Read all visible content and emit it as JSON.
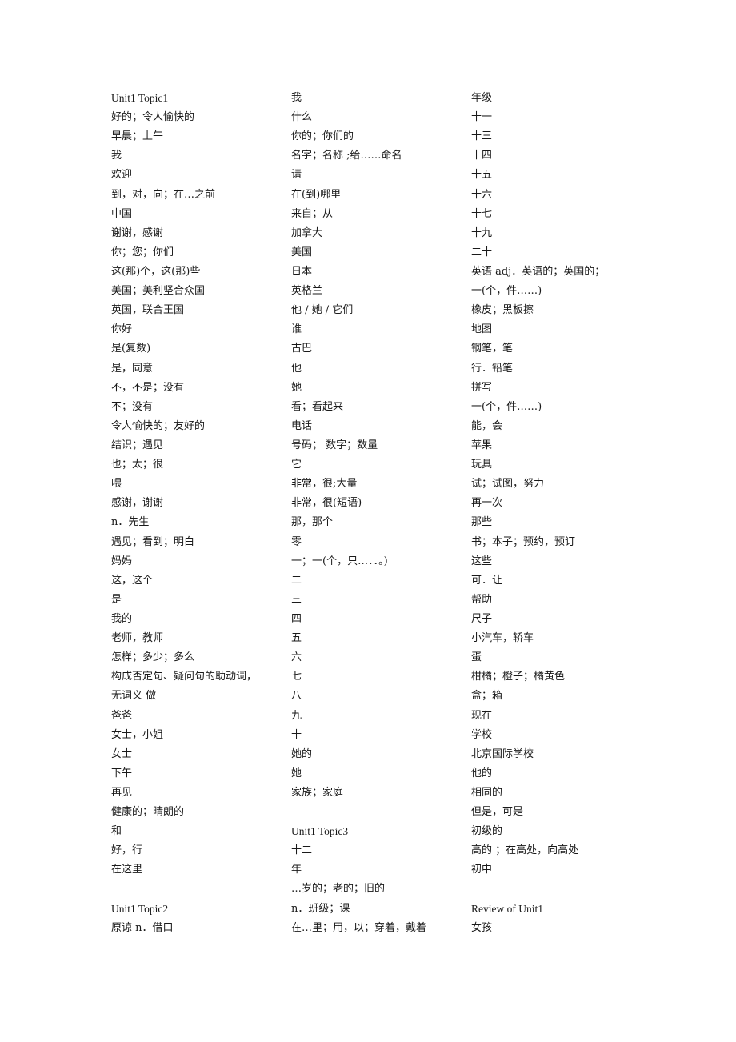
{
  "document": {
    "columns": [
      {
        "sections": [
          {
            "heading": "Unit1 Topic1",
            "entries": [
              "好的；令人愉快的",
              "早晨；上午",
              "我",
              "欢迎",
              "到，对，向；在…之前",
              "中国",
              "谢谢，感谢",
              "你；您；你们",
              "这(那)个，这(那)些",
              "美国；美利坚合众国",
              "英国，联合王国",
              "你好",
              "是(复数)",
              "是，同意",
              "不，不是；没有",
              "不；没有",
              "令人愉快的；友好的",
              "结识；遇见",
              "也；太；很",
              "喂",
              "感谢，谢谢",
              "n．先生",
              "遇见；看到；明白",
              "妈妈",
              "这，这个",
              "是",
              "我的",
              "老师，教师",
              "怎样；多少；多么",
              "构成否定句、疑问句的助动词，",
              "无词义  做",
              "爸爸",
              "女士，小姐",
              "女士",
              "下午",
              "再见",
              "健康的；晴朗的",
              "和",
              "好，行",
              "在这里"
            ]
          },
          {
            "heading": "Unit1 Topic2",
            "entries": [
              "原谅  n．借口"
            ]
          }
        ]
      },
      {
        "sections": [
          {
            "heading": null,
            "entries": [
              "我",
              "什么",
              "你的；你们的",
              "名字；名称  ;给……命名",
              "请",
              "在(到)哪里",
              "来自；从",
              "加拿大",
              "美国",
              "日本",
              "英格兰",
              "他 / 她 / 它们",
              "谁",
              "古巴",
              "他",
              "她",
              "看；看起来",
              "电话",
              "号码；  数字；数量",
              "它",
              "非常，很;大量",
              "非常，很(短语)",
              "那，那个",
              "零",
              "一；一(个，只…．．。)",
              "二",
              "三",
              "四",
              "五",
              "六",
              "七",
              "八",
              "九",
              "十",
              "她的",
              "她",
              "家族；家庭"
            ]
          },
          {
            "heading": "Unit1 Topic3",
            "entries": [
              "十二",
              "年",
              "…岁的；老的；旧的",
              "n．班级；课",
              "在…里；用，以；穿着，戴着"
            ]
          }
        ]
      },
      {
        "sections": [
          {
            "heading": null,
            "entries": [
              "年级",
              "十一",
              "十三",
              "十四",
              "十五",
              "十六",
              "十七",
              "十九",
              "二十",
              "英语      adj．英语的；英国的；",
              "一(个，件……)",
              "橡皮；黑板擦",
              "地图",
              "钢笔，笔",
              "行．铅笔",
              "拼写",
              "一(个，件……)",
              "能，会",
              "苹果",
              "玩具",
              "试；试图，努力",
              "再一次",
              "那些",
              "书；本子；预约，预订",
              "这些",
              "可．让",
              "帮助",
              "尺子",
              "小汽车，轿车",
              "蛋",
              "柑橘；橙子；橘黄色",
              "盒；箱",
              "现在",
              "学校",
              "北京国际学校",
              "他的",
              "相同的",
              "但是，可是",
              "初级的",
              "高的  ；在高处，向高处",
              "初中"
            ]
          },
          {
            "heading": "Review of Unit1",
            "entries": [
              "女孩"
            ]
          }
        ]
      }
    ]
  }
}
